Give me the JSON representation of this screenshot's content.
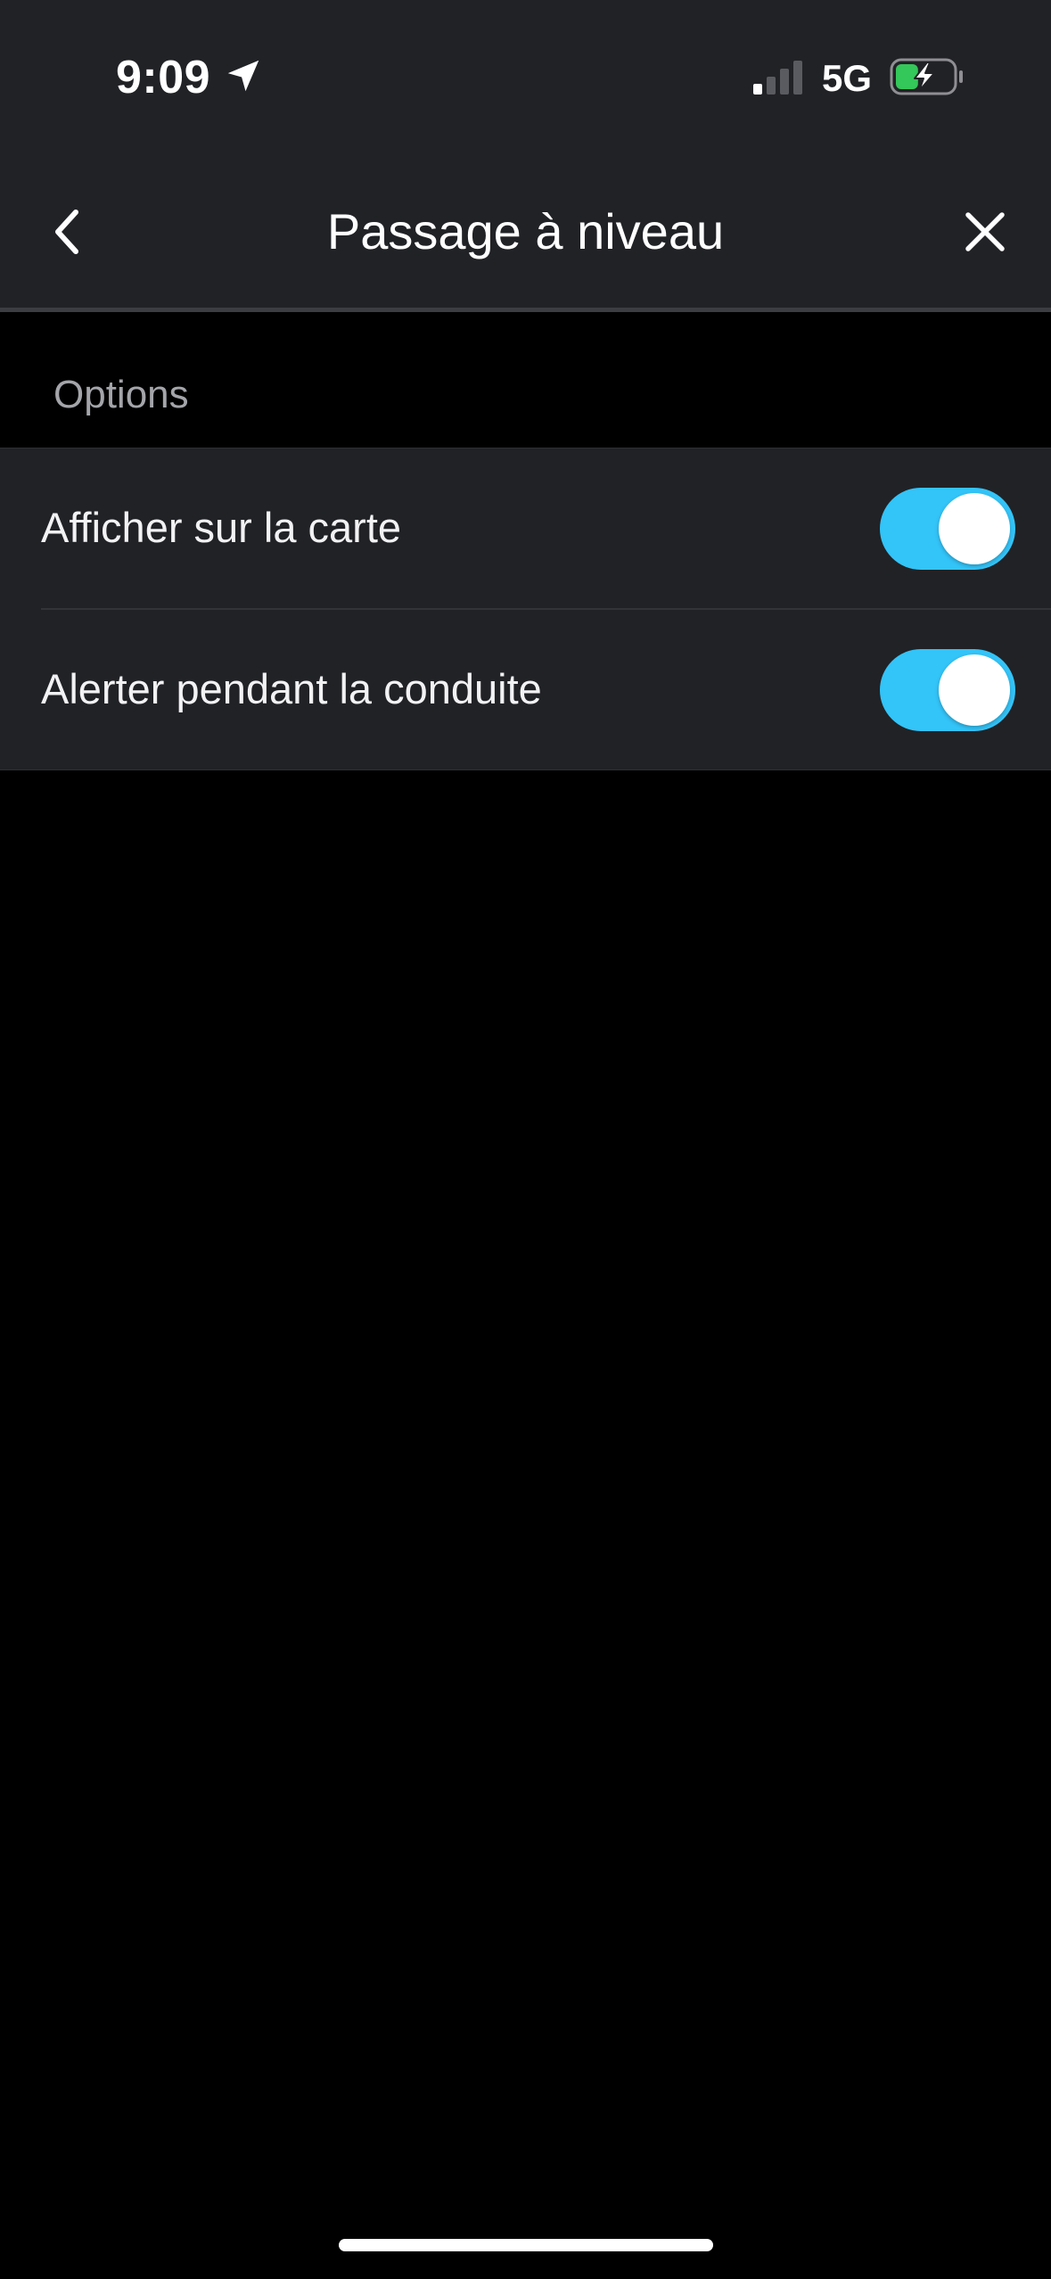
{
  "status_bar": {
    "time": "9:09",
    "network": "5G",
    "location_icon": "location-arrow-icon",
    "signal_icon": "cellular-signal-icon",
    "signal_bars_active": 1,
    "signal_bars_total": 4,
    "battery_icon": "battery-charging-icon",
    "battery_level": 0.4
  },
  "nav": {
    "title": "Passage à niveau",
    "back_icon": "chevron-left-icon",
    "close_icon": "close-icon"
  },
  "options": {
    "header": "Options",
    "items": [
      {
        "label": "Afficher sur la carte",
        "enabled": true
      },
      {
        "label": "Alerter pendant la conduite",
        "enabled": true
      }
    ]
  },
  "colors": {
    "background": "#000000",
    "surface": "#212226",
    "toggle_on": "#33c4f8",
    "toggle_off": "#3a3b40",
    "battery_fill": "#34c759",
    "secondary_text": "#a4a5aa"
  }
}
